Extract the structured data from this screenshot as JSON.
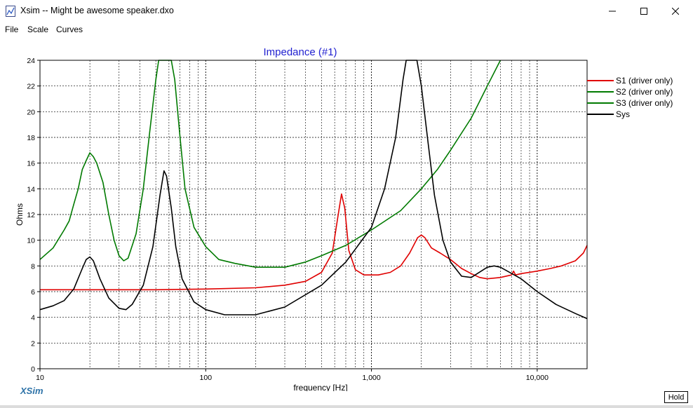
{
  "window": {
    "title": "Xsim -- Might be awesome speaker.dxo",
    "controls": [
      "minimize-icon",
      "maximize-icon",
      "close-icon"
    ]
  },
  "menu": [
    "File",
    "Scale",
    "Curves"
  ],
  "footer": {
    "logo": "XSim",
    "hold_label": "Hold"
  },
  "colors": {
    "s1": "#e00000",
    "s2": "#007a00",
    "s3": "#007a00",
    "sys": "#000000",
    "title": "#1f1fd0",
    "grid": "#000000",
    "logo": "#2e73a8"
  },
  "chart_data": {
    "type": "line",
    "title": "Impedance (#1)",
    "xlabel": "frequency [Hz]",
    "ylabel": "Ohms",
    "x_scale": "log",
    "xlim": [
      10,
      20000
    ],
    "ylim": [
      0,
      24
    ],
    "grid": true,
    "legend_position": "right",
    "x_tick_labels": [
      "10",
      "100",
      "1,000",
      "10,000"
    ],
    "y_ticks": [
      0,
      2,
      4,
      6,
      8,
      10,
      12,
      14,
      16,
      18,
      20,
      22,
      24
    ],
    "series": [
      {
        "name": "S1 (driver only)",
        "color": "#e00000",
        "points": [
          [
            10,
            6.15
          ],
          [
            50,
            6.15
          ],
          [
            100,
            6.2
          ],
          [
            200,
            6.3
          ],
          [
            300,
            6.5
          ],
          [
            400,
            6.8
          ],
          [
            500,
            7.5
          ],
          [
            580,
            9.0
          ],
          [
            630,
            12.0
          ],
          [
            660,
            13.6
          ],
          [
            690,
            12.5
          ],
          [
            730,
            9.2
          ],
          [
            800,
            7.7
          ],
          [
            900,
            7.3
          ],
          [
            1100,
            7.3
          ],
          [
            1300,
            7.5
          ],
          [
            1500,
            8.0
          ],
          [
            1700,
            9.0
          ],
          [
            1900,
            10.2
          ],
          [
            2000,
            10.4
          ],
          [
            2100,
            10.2
          ],
          [
            2300,
            9.4
          ],
          [
            2600,
            9.0
          ],
          [
            3000,
            8.5
          ],
          [
            3500,
            7.8
          ],
          [
            4000,
            7.4
          ],
          [
            4500,
            7.1
          ],
          [
            5000,
            7.0
          ],
          [
            6000,
            7.1
          ],
          [
            7000,
            7.3
          ],
          [
            7200,
            7.6
          ],
          [
            7400,
            7.3
          ],
          [
            8000,
            7.4
          ],
          [
            10000,
            7.6
          ],
          [
            12000,
            7.8
          ],
          [
            14000,
            8.0
          ],
          [
            17000,
            8.4
          ],
          [
            19000,
            9.0
          ],
          [
            20000,
            9.6
          ]
        ]
      },
      {
        "name": "S2 (driver only)",
        "color": "#007a00",
        "points": [
          [
            10,
            8.5
          ],
          [
            12,
            9.4
          ],
          [
            14,
            10.8
          ],
          [
            15,
            11.5
          ],
          [
            16,
            12.8
          ],
          [
            17,
            14.0
          ],
          [
            18,
            15.5
          ],
          [
            19,
            16.2
          ],
          [
            20,
            16.8
          ],
          [
            21,
            16.5
          ],
          [
            22,
            16.0
          ],
          [
            24,
            14.5
          ],
          [
            26,
            12.0
          ],
          [
            28,
            10.0
          ],
          [
            30,
            8.8
          ],
          [
            32,
            8.4
          ],
          [
            34,
            8.6
          ],
          [
            38,
            10.5
          ],
          [
            42,
            14.0
          ],
          [
            46,
            18.5
          ],
          [
            50,
            22.5
          ],
          [
            52,
            24
          ],
          [
            62,
            24
          ],
          [
            65,
            22.5
          ],
          [
            70,
            18.0
          ],
          [
            75,
            14.0
          ],
          [
            85,
            11.0
          ],
          [
            100,
            9.5
          ],
          [
            120,
            8.5
          ],
          [
            150,
            8.2
          ],
          [
            200,
            7.9
          ],
          [
            300,
            7.9
          ],
          [
            400,
            8.3
          ],
          [
            500,
            8.8
          ],
          [
            700,
            9.6
          ],
          [
            1000,
            10.8
          ],
          [
            1500,
            12.3
          ],
          [
            2000,
            14.0
          ],
          [
            2500,
            15.5
          ],
          [
            3000,
            17.0
          ],
          [
            4000,
            19.5
          ],
          [
            5000,
            22.0
          ],
          [
            6000,
            24.0
          ]
        ]
      },
      {
        "name": "S3 (driver only)",
        "color": "#007a00",
        "points": []
      },
      {
        "name": "Sys",
        "color": "#000000",
        "points": [
          [
            10,
            4.6
          ],
          [
            12,
            4.9
          ],
          [
            14,
            5.3
          ],
          [
            16,
            6.2
          ],
          [
            18,
            7.8
          ],
          [
            19,
            8.5
          ],
          [
            20,
            8.7
          ],
          [
            21,
            8.4
          ],
          [
            23,
            7.0
          ],
          [
            26,
            5.5
          ],
          [
            30,
            4.7
          ],
          [
            33,
            4.6
          ],
          [
            36,
            5.0
          ],
          [
            42,
            6.5
          ],
          [
            48,
            9.5
          ],
          [
            53,
            13.5
          ],
          [
            56,
            15.4
          ],
          [
            58,
            15.0
          ],
          [
            62,
            12.5
          ],
          [
            66,
            9.5
          ],
          [
            72,
            7.0
          ],
          [
            85,
            5.2
          ],
          [
            100,
            4.6
          ],
          [
            130,
            4.2
          ],
          [
            200,
            4.2
          ],
          [
            300,
            4.8
          ],
          [
            500,
            6.5
          ],
          [
            700,
            8.3
          ],
          [
            1000,
            11.0
          ],
          [
            1200,
            14.0
          ],
          [
            1400,
            18.0
          ],
          [
            1550,
            22.5
          ],
          [
            1620,
            24.0
          ],
          [
            1880,
            24.0
          ],
          [
            2000,
            22.0
          ],
          [
            2200,
            17.5
          ],
          [
            2400,
            13.5
          ],
          [
            2700,
            10.0
          ],
          [
            3000,
            8.3
          ],
          [
            3500,
            7.2
          ],
          [
            4000,
            7.1
          ],
          [
            5000,
            7.9
          ],
          [
            5500,
            8.0
          ],
          [
            6000,
            7.9
          ],
          [
            8000,
            7.0
          ],
          [
            10000,
            6.0
          ],
          [
            13000,
            5.0
          ],
          [
            17000,
            4.3
          ],
          [
            20000,
            3.9
          ]
        ]
      }
    ]
  }
}
